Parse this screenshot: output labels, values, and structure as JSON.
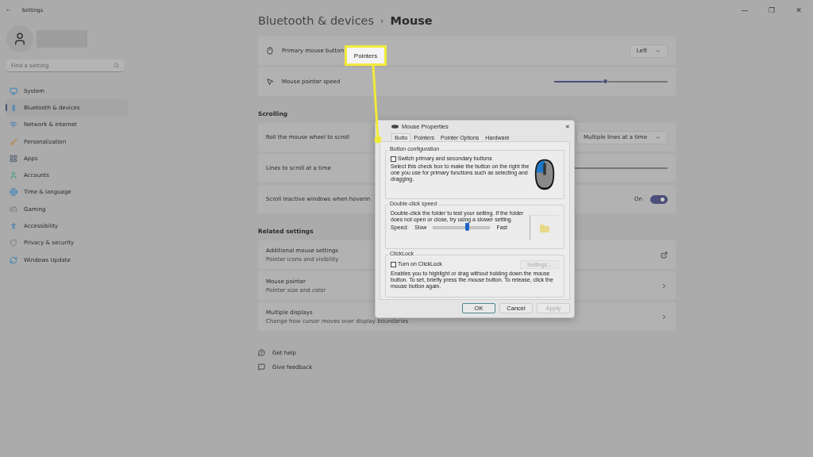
{
  "window": {
    "title": "Settings",
    "back": "←",
    "controls": [
      "—",
      "❐",
      "✕"
    ]
  },
  "search": {
    "placeholder": "Find a setting"
  },
  "nav": [
    {
      "label": "System",
      "selected": false
    },
    {
      "label": "Bluetooth & devices",
      "selected": true
    },
    {
      "label": "Network & internet",
      "selected": false
    },
    {
      "label": "Personalization",
      "selected": false
    },
    {
      "label": "Apps",
      "selected": false
    },
    {
      "label": "Accounts",
      "selected": false
    },
    {
      "label": "Time & language",
      "selected": false
    },
    {
      "label": "Gaming",
      "selected": false
    },
    {
      "label": "Accessibility",
      "selected": false
    },
    {
      "label": "Privacy & security",
      "selected": false
    },
    {
      "label": "Windows Update",
      "selected": false
    }
  ],
  "breadcrumb": {
    "parent": "Bluetooth & devices",
    "separator": "›",
    "current": "Mouse"
  },
  "mouse_rows": [
    {
      "kind": "dropdown",
      "label": "Primary mouse button",
      "value": "Left"
    },
    {
      "kind": "slider",
      "label": "Mouse pointer speed",
      "level": 0.45
    }
  ],
  "scrolling": {
    "heading": "Scrolling",
    "rows": [
      {
        "kind": "dropdown",
        "label": "Roll the mouse wheel to scroll",
        "value": "Multiple lines at a time"
      },
      {
        "kind": "slider",
        "label": "Lines to scroll at a time",
        "level": 0.03
      },
      {
        "kind": "toggle",
        "label": "Scroll inactive windows when hoverin",
        "value": "On",
        "on": true
      }
    ]
  },
  "related": {
    "heading": "Related settings",
    "rows": [
      {
        "kind": "external",
        "title": "Additional mouse settings",
        "subtitle": "Pointer icons and visibility"
      },
      {
        "kind": "chevron",
        "title": "Mouse pointer",
        "subtitle": "Pointer size and color"
      },
      {
        "kind": "chevron",
        "title": "Multiple displays",
        "subtitle": "Change how cursor moves over display boundaries"
      }
    ]
  },
  "help_links": [
    "Get help",
    "Give feedback"
  ],
  "dialog": {
    "title": "Mouse Properties",
    "close": "✕",
    "tabs": [
      {
        "label": "Butto",
        "selected": true
      },
      {
        "label": "Pointers",
        "selected": false
      },
      {
        "label": "Pointer Options",
        "selected": false
      },
      {
        "label": "Hardware",
        "selected": false
      }
    ],
    "button_config": {
      "heading": "Button configuration",
      "checkbox": {
        "label": "Switch primary and secondary buttons",
        "checked": false
      },
      "description": "Select this check box to make the button on the right the one you use for primary functions such as selecting and dragging."
    },
    "double_click": {
      "heading": "Double-click speed",
      "description": "Double-click the folder to test your setting. If the folder does not open or close, try using a slower setting.",
      "speed_label": "Speed:",
      "slow": "Slow",
      "fast": "Fast",
      "level": 0.6
    },
    "clicklock": {
      "heading": "ClickLock",
      "checkbox": {
        "label": "Turn on ClickLock",
        "checked": false
      },
      "settings_button": {
        "label": "Settings...",
        "disabled": true
      },
      "description": "Enables you to highlight or drag without holding down the mouse button. To set, briefly press the mouse button. To release, click the mouse button again."
    },
    "buttons": [
      {
        "label": "OK",
        "disabled": false,
        "default": true
      },
      {
        "label": "Cancel",
        "disabled": false,
        "default": false
      },
      {
        "label": "Apply",
        "disabled": true,
        "default": false
      }
    ]
  },
  "callout": {
    "label": "Pointers"
  }
}
